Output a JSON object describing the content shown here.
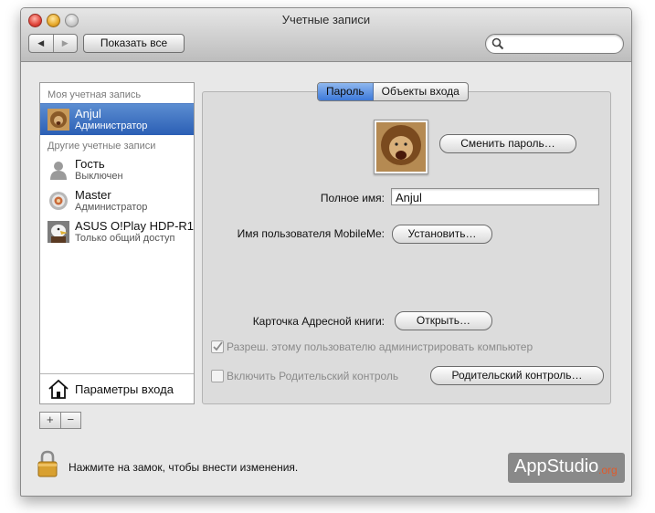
{
  "window": {
    "title": "Учетные записи"
  },
  "toolbar": {
    "back": "◀",
    "forward": "▶",
    "show_all": "Показать все",
    "search_placeholder": ""
  },
  "sidebar": {
    "my_account_header": "Моя учетная запись",
    "other_accounts_header": "Другие учетные записи",
    "accounts": [
      {
        "name": "Anjul",
        "role": "Администратор",
        "selected": true,
        "icon": "lion-icon"
      },
      {
        "name": "Гость",
        "role": "Выключен",
        "selected": false,
        "icon": "guest-icon"
      },
      {
        "name": "Master",
        "role": "Администратор",
        "selected": false,
        "icon": "target-icon"
      },
      {
        "name": "ASUS O!Play HDP-R1",
        "role": "Только общий доступ",
        "selected": false,
        "icon": "eagle-icon"
      }
    ],
    "login_options": "Параметры входа",
    "add": "+",
    "remove": "−"
  },
  "tabs": [
    {
      "label": "Пароль",
      "active": true
    },
    {
      "label": "Объекты входа",
      "active": false
    }
  ],
  "main": {
    "change_password": "Сменить пароль…",
    "full_name_label": "Полное имя:",
    "full_name_value": "Anjul",
    "mobileme_label": "Имя пользователя MobileMe:",
    "mobileme_button": "Установить…",
    "address_book_label": "Карточка Адресной книги:",
    "open_button": "Открыть…",
    "allow_admin_label": "Разреш. этому пользователю администрировать компьютер",
    "allow_admin_checked": true,
    "parental_label": "Включить Родительский контроль",
    "parental_checked": false,
    "parental_button": "Родительский контроль…"
  },
  "footer": {
    "lock_text": "Нажмите на замок, чтобы внести изменения."
  },
  "watermark": {
    "main": "AppStudio",
    "sub": ".org"
  },
  "colors": {
    "selection": "#2b5fb5",
    "tab_active": "#3d79d9",
    "window_bg": "#e8e8e8"
  }
}
